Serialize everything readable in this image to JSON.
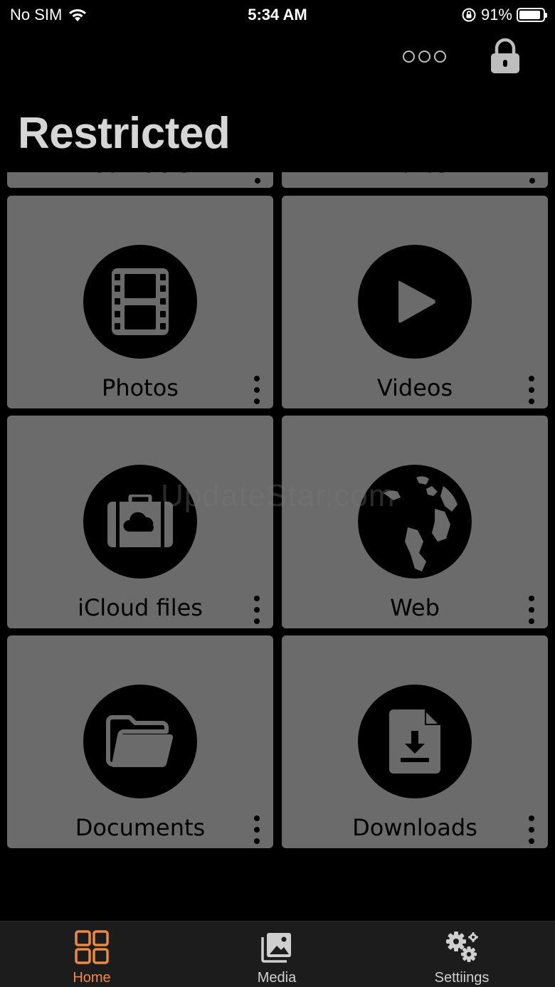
{
  "status_bar": {
    "carrier": "No SIM",
    "time": "5:34 AM",
    "battery_percent": "91%",
    "battery_level": 0.91
  },
  "toolbar": {
    "more_icon": "more-circles-icon",
    "lock_icon": "lock-icon"
  },
  "page": {
    "title": "Restricted"
  },
  "partial_tiles": [
    {
      "label": "Contacts"
    },
    {
      "label": "Notes"
    }
  ],
  "tiles": [
    {
      "label": "Photos",
      "icon": "film-icon"
    },
    {
      "label": "Videos",
      "icon": "play-icon"
    },
    {
      "label": "iCloud files",
      "icon": "icloud-briefcase-icon"
    },
    {
      "label": "Web",
      "icon": "globe-icon"
    },
    {
      "label": "Documents",
      "icon": "folder-icon"
    },
    {
      "label": "Downloads",
      "icon": "download-file-icon"
    }
  ],
  "watermark": "UpdateStar.com",
  "tab_bar": {
    "tabs": [
      {
        "label": "Home",
        "icon": "grid-icon",
        "active": true
      },
      {
        "label": "Media",
        "icon": "photos-icon",
        "active": false
      },
      {
        "label": "Settiings",
        "icon": "gears-icon",
        "active": false
      }
    ]
  },
  "colors": {
    "accent": "#f08a3a",
    "tile": "#6b6b6b",
    "background": "#000000",
    "tab_bar": "#1c1c1c",
    "inactive_tab": "#cfcfcf"
  }
}
